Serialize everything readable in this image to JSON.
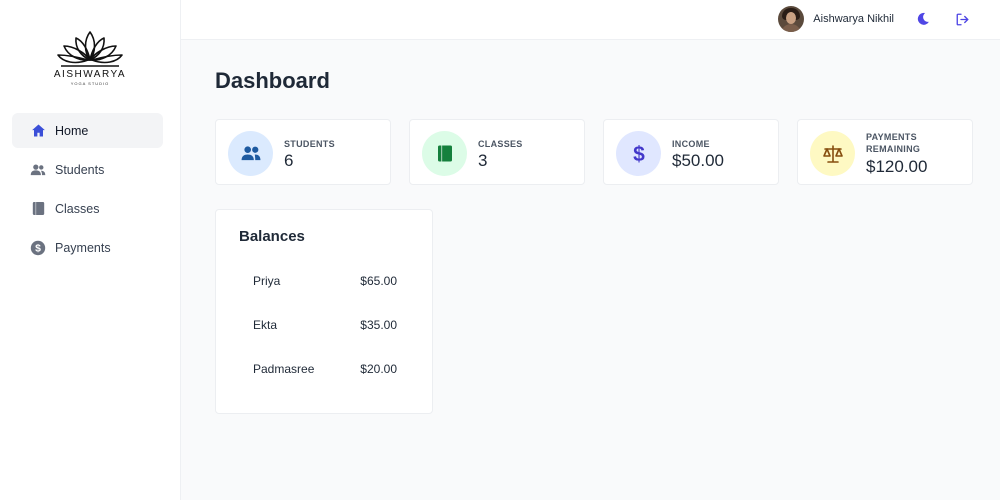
{
  "brand": {
    "name": "AISHWARYA",
    "subtitle": "YOGA STUDIO"
  },
  "sidebar": {
    "items": [
      {
        "label": "Home",
        "icon": "home-icon",
        "active": true
      },
      {
        "label": "Students",
        "icon": "users-icon"
      },
      {
        "label": "Classes",
        "icon": "book-icon"
      },
      {
        "label": "Payments",
        "icon": "dollar-circle-icon"
      }
    ]
  },
  "header": {
    "user_name": "Aishwarya Nikhil",
    "theme_icon": "moon-icon",
    "logout_icon": "logout-icon"
  },
  "main": {
    "title": "Dashboard"
  },
  "stats": [
    {
      "label": "STUDENTS",
      "value": "6",
      "icon": "users-icon",
      "bg": "#dbeafe",
      "fg": "#1e5aa0"
    },
    {
      "label": "CLASSES",
      "value": "3",
      "icon": "book-icon",
      "bg": "#dcfce7",
      "fg": "#15803d"
    },
    {
      "label": "INCOME",
      "value": "$50.00",
      "icon": "dollar-icon",
      "bg": "#e0e7ff",
      "fg": "#4338ca"
    },
    {
      "label": "PAYMENTS REMAINING",
      "value": "$120.00",
      "icon": "scale-icon",
      "bg": "#fef9c3",
      "fg": "#854d0e"
    }
  ],
  "balances": {
    "title": "Balances",
    "rows": [
      {
        "name": "Priya",
        "amount": "$65.00"
      },
      {
        "name": "Ekta",
        "amount": "$35.00"
      },
      {
        "name": "Padmasree",
        "amount": "$20.00"
      }
    ]
  },
  "colors": {
    "accent": "#4f46e5",
    "home_icon": "#3b4fd8",
    "nav_icon": "#6b7280"
  }
}
